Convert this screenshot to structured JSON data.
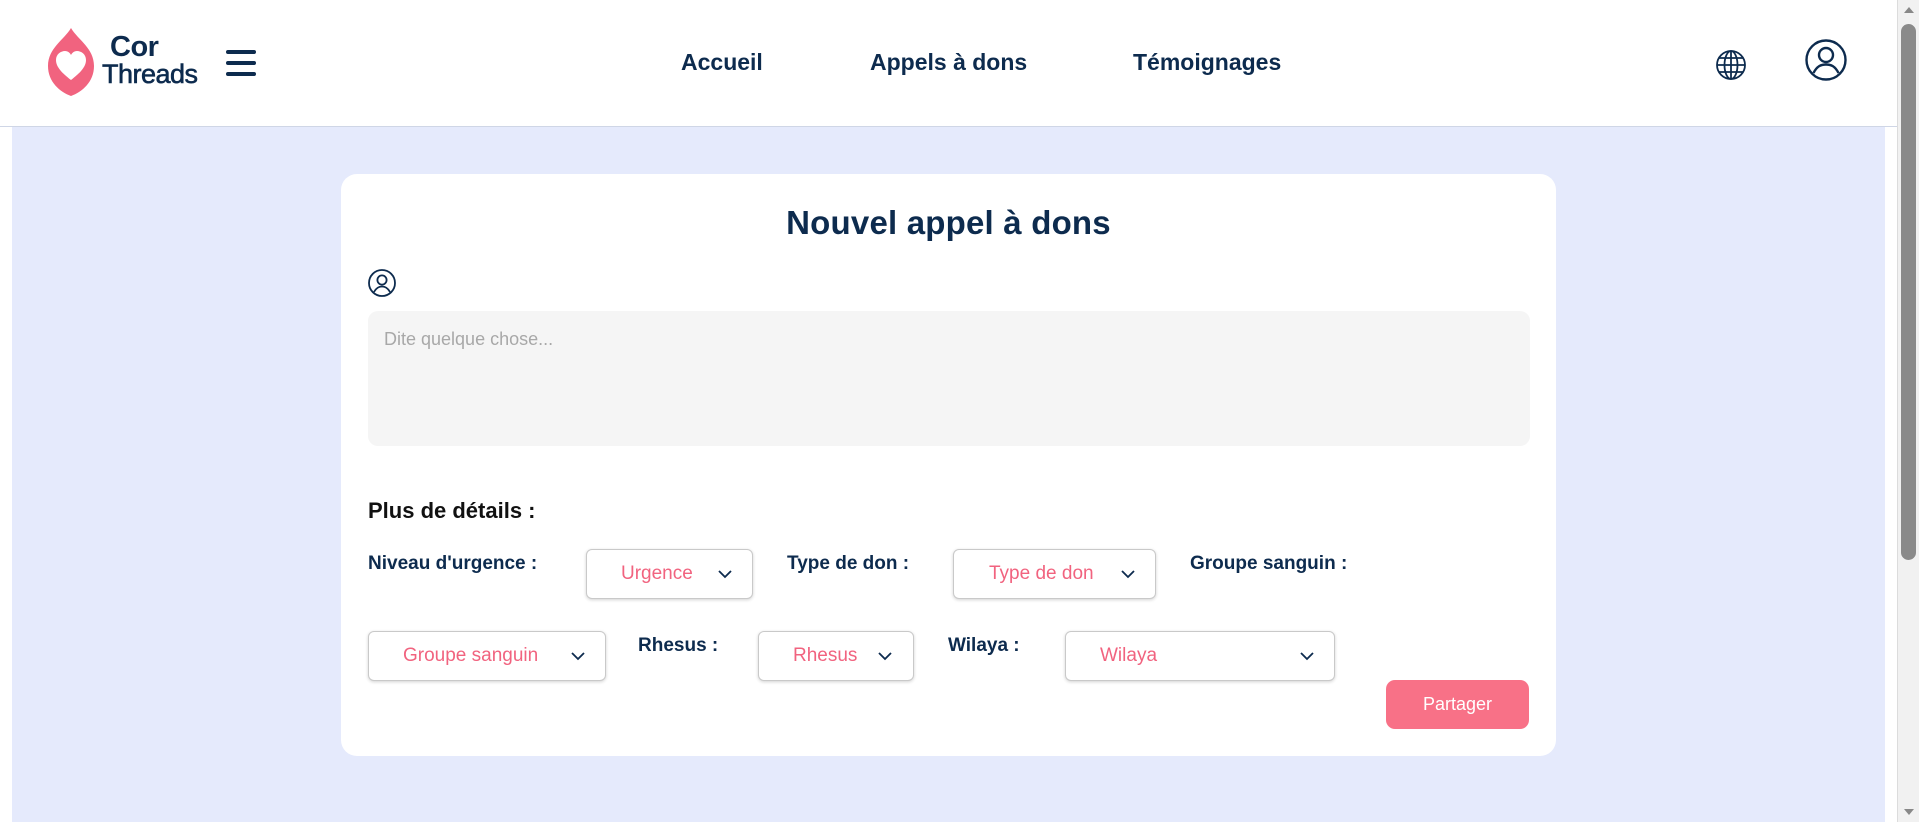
{
  "header": {
    "logo": {
      "line1": "Cor",
      "line2": "Threads"
    },
    "nav": [
      "Accueil",
      "Appels à dons",
      "Témoignages"
    ]
  },
  "colors": {
    "primary": "#0d2b4e",
    "accent": "#f87187",
    "background": "#e5eafc"
  },
  "icons": {
    "menu": "hamburger-menu-icon",
    "language": "globe-icon",
    "account": "user-circle-icon",
    "author": "user-circle-icon",
    "dropdown": "chevron-down-icon"
  },
  "form": {
    "title": "Nouvel appel à dons",
    "message_placeholder": "Dite quelque chose...",
    "message_value": "",
    "details_heading": "Plus de détails :",
    "fields": {
      "urgency": {
        "label": "Niveau d'urgence :",
        "value": "Urgence"
      },
      "donation_type": {
        "label": "Type de don :",
        "value": "Type de don"
      },
      "blood_group": {
        "label": "Groupe sanguin :",
        "value": "Groupe sanguin"
      },
      "rhesus": {
        "label": "Rhesus :",
        "value": "Rhesus"
      },
      "wilaya": {
        "label": "Wilaya :",
        "value": "Wilaya"
      }
    },
    "submit_label": "Partager"
  }
}
